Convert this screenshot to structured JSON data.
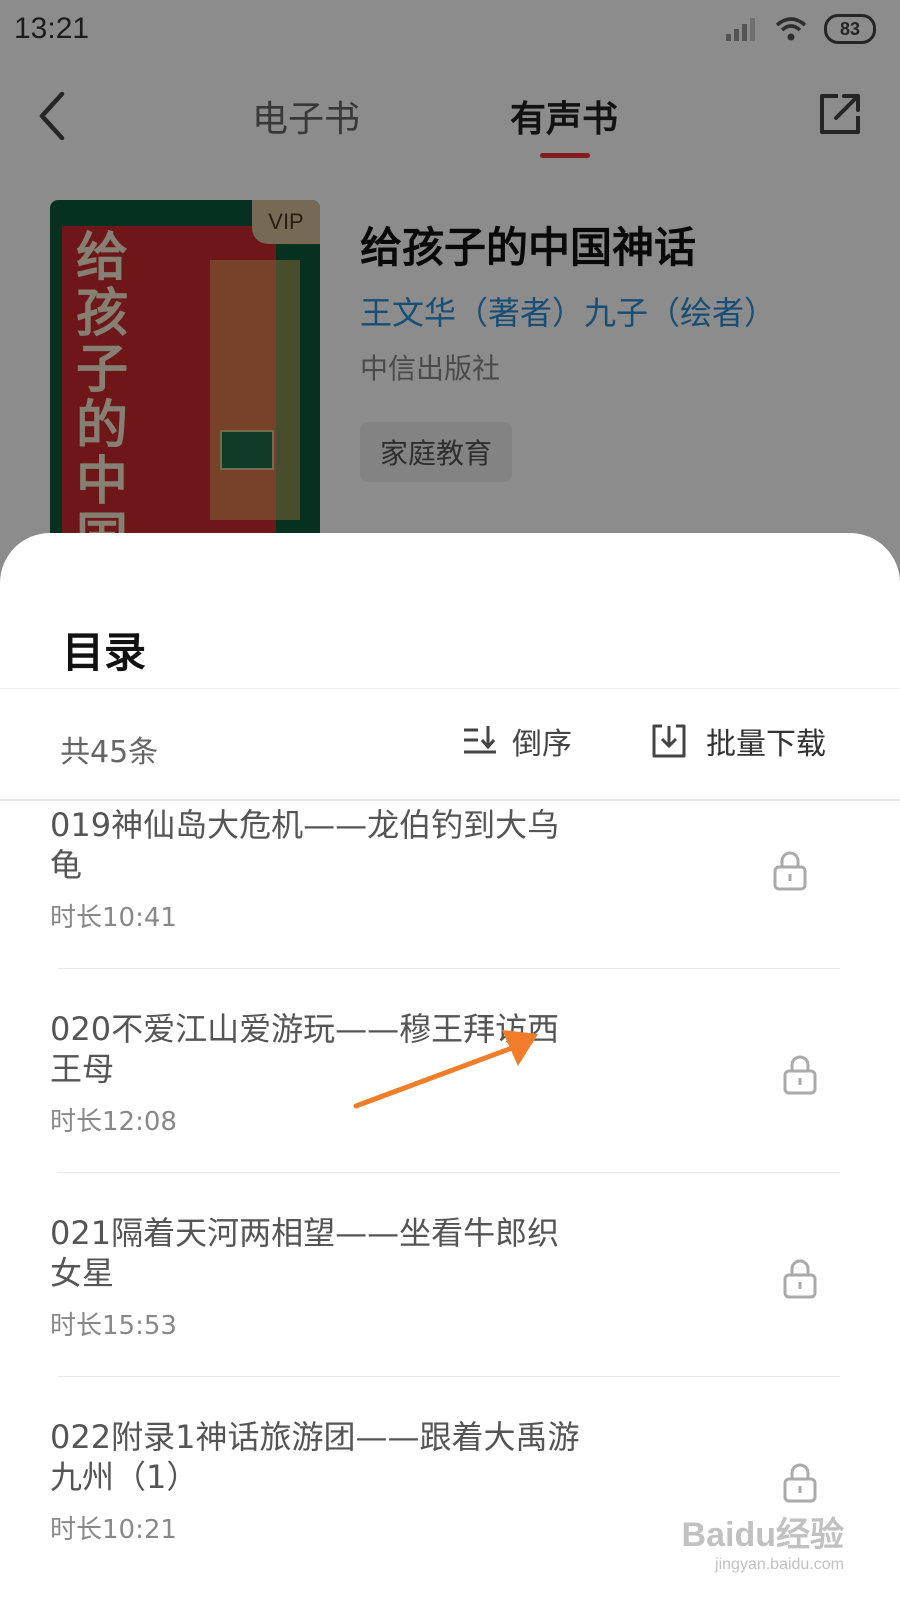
{
  "status_bar": {
    "time": "13:21",
    "battery": "83",
    "icons": [
      "signal-icon",
      "wifi-icon",
      "battery-icon"
    ]
  },
  "nav": {
    "tabs": [
      "电子书",
      "有声书"
    ],
    "active_tab": "有声书",
    "accent_color": "#e33333"
  },
  "book": {
    "cover_badge": "VIP",
    "cover_title": "给孩子的中国神话",
    "title": "给孩子的中国神话",
    "authors": "王文华（著者）九子（绘者）",
    "publisher": "中信出版社",
    "tag": "家庭教育",
    "author_color": "#2a8fd8"
  },
  "sheet": {
    "title": "目录",
    "count": "共45条",
    "sort_label": "倒序",
    "download_label": "批量下载"
  },
  "chapters": [
    {
      "title": "019神仙岛大危机——龙伯钓到大乌龟",
      "duration": "时长10:41",
      "locked": true
    },
    {
      "title": "020不爱江山爱游玩——穆王拜访西王母",
      "duration": "时长12:08",
      "locked": true
    },
    {
      "title": "021隔着天河两相望——坐看牛郎织女星",
      "duration": "时长15:53",
      "locked": true
    },
    {
      "title": "022附录1神话旅游团——跟着大禹游九州（1）",
      "duration": "时长10:21",
      "locked": true
    }
  ],
  "annotation": {
    "color": "#f07d2a"
  },
  "watermark": {
    "logo": "Baidu经验",
    "url": "jingyan.baidu.com"
  }
}
